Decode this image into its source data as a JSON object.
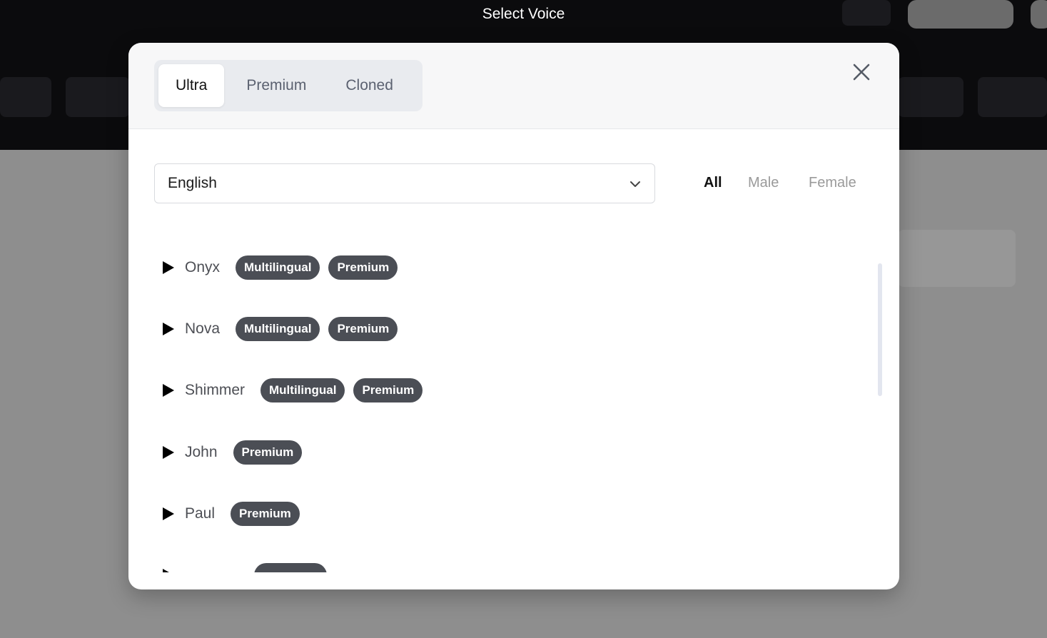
{
  "overlay": {
    "title": "Select Voice"
  },
  "tabs": [
    {
      "label": "Ultra",
      "active": true
    },
    {
      "label": "Premium",
      "active": false
    },
    {
      "label": "Cloned",
      "active": false
    }
  ],
  "language_select": {
    "value": "English"
  },
  "gender_filters": [
    {
      "label": "All",
      "active": true
    },
    {
      "label": "Male",
      "active": false
    },
    {
      "label": "Female",
      "active": false
    }
  ],
  "voices": [
    {
      "name": "Onyx",
      "badges": [
        "Multilingual",
        "Premium"
      ]
    },
    {
      "name": "Nova",
      "badges": [
        "Multilingual",
        "Premium"
      ]
    },
    {
      "name": "Shimmer",
      "badges": [
        "Multilingual",
        "Premium"
      ]
    },
    {
      "name": "John",
      "badges": [
        "Premium"
      ]
    },
    {
      "name": "Paul",
      "badges": [
        "Premium"
      ]
    },
    {
      "name": "",
      "badges": [
        ""
      ]
    }
  ],
  "icons": {
    "close": "close-icon",
    "chevron": "chevron-down-icon",
    "play": "play-icon"
  },
  "colors": {
    "badge_bg": "#4b4e55",
    "tab_track": "#e9ebef",
    "header_bg": "#f7f7f8"
  }
}
